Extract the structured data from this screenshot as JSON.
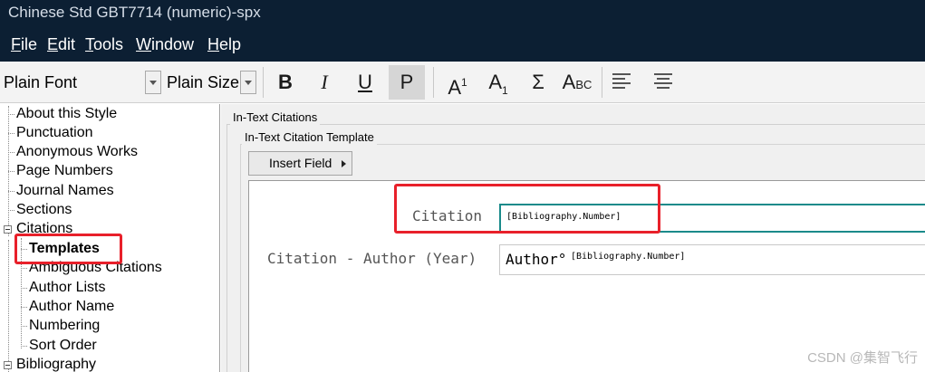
{
  "window": {
    "title": "Chinese Std GBT7714 (numeric)-spx"
  },
  "menu": {
    "items": [
      {
        "key": "F",
        "rest": "ile"
      },
      {
        "key": "E",
        "rest": "dit"
      },
      {
        "key": "T",
        "rest": "ools"
      },
      {
        "key": "W",
        "rest": "indow"
      },
      {
        "key": "H",
        "rest": "elp"
      }
    ]
  },
  "toolbar": {
    "font": "Plain Font",
    "size": "Plain Size",
    "bold": "B",
    "italic": "I",
    "underline": "U",
    "plain": "P",
    "superscript_base": "A",
    "superscript_mark": "1",
    "subscript_base": "A",
    "subscript_mark": "1",
    "symbol": "Σ",
    "smallcaps_a": "A",
    "smallcaps_bc": "BC",
    "align_left_icon": "align-left-icon",
    "align_center_icon": "align-center-icon"
  },
  "tree": {
    "items": [
      "About this Style",
      "Punctuation",
      "Anonymous Works",
      "Page Numbers",
      "Journal Names",
      "Sections",
      "Citations",
      "Templates",
      "Ambiguous Citations",
      "Author Lists",
      "Author Name",
      "Numbering",
      "Sort Order",
      "Bibliography"
    ],
    "selected": "Templates"
  },
  "panel": {
    "group_title": "In-Text Citations",
    "subgroup_title": "In-Text Citation Template",
    "insert_field": "Insert Field",
    "fields": [
      {
        "label": "Citation",
        "value": "[Bibliography.Number]"
      },
      {
        "label": "Citation - Author (Year)",
        "prefix": "Author°",
        "value": "[Bibliography.Number]"
      }
    ]
  },
  "watermark": "CSDN @集智飞行",
  "colors": {
    "titlebar": "#0c1f33",
    "highlight": "#e8202a",
    "active_field_border": "#1a8a8a"
  }
}
